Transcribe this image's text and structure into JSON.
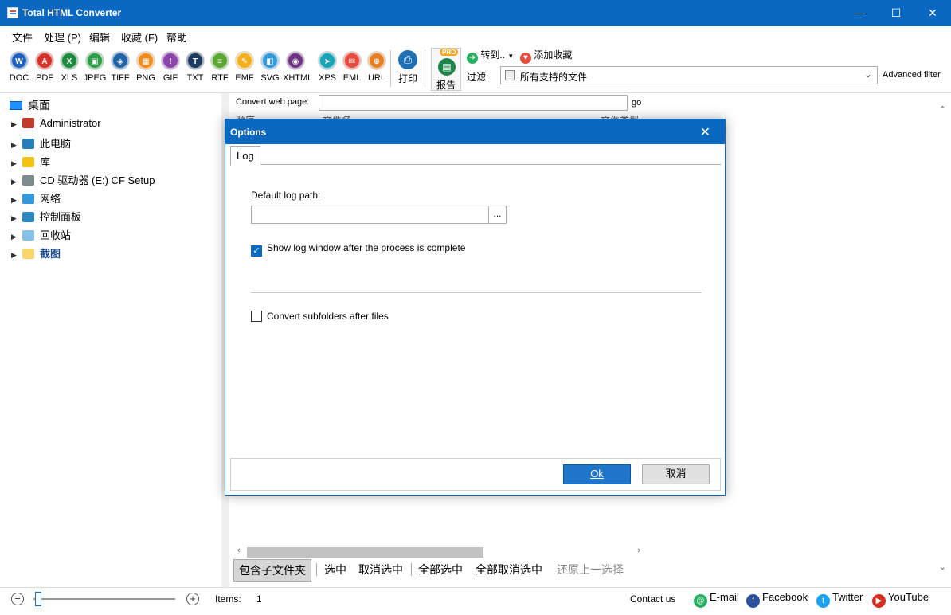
{
  "window": {
    "title": "Total HTML Converter",
    "min": "—",
    "max": "☐",
    "close": "✕"
  },
  "menu": [
    "文件",
    "处理 (P)",
    "编辑",
    "收藏 (F)",
    "帮助"
  ],
  "toolbar": {
    "formats": [
      {
        "label": "DOC",
        "glyph": "W",
        "color": "#1f5fbf",
        "icon": "word-icon"
      },
      {
        "label": "PDF",
        "glyph": "A",
        "color": "#d7322a",
        "icon": "pdf-icon"
      },
      {
        "label": "XLS",
        "glyph": "X",
        "color": "#1e8a3d",
        "icon": "excel-icon"
      },
      {
        "label": "JPEG",
        "glyph": "▣",
        "color": "#2e9e48",
        "icon": "jpeg-icon"
      },
      {
        "label": "TIFF",
        "glyph": "◈",
        "color": "#1f63a8",
        "icon": "tiff-icon"
      },
      {
        "label": "PNG",
        "glyph": "▦",
        "color": "#f08c1e",
        "icon": "png-icon"
      },
      {
        "label": "GIF",
        "glyph": "!",
        "color": "#8e44ad",
        "icon": "gif-icon"
      },
      {
        "label": "TXT",
        "glyph": "T",
        "color": "#1f3a5f",
        "icon": "txt-icon"
      },
      {
        "label": "RTF",
        "glyph": "≡",
        "color": "#5aa832",
        "icon": "rtf-icon"
      },
      {
        "label": "EMF",
        "glyph": "✎",
        "color": "#f2b01e",
        "icon": "emf-icon"
      },
      {
        "label": "SVG",
        "glyph": "◧",
        "color": "#3498db",
        "icon": "svg-icon"
      },
      {
        "label": "XHTML",
        "glyph": "◉",
        "color": "#6c3483",
        "icon": "xhtml-icon"
      },
      {
        "label": "XPS",
        "glyph": "➤",
        "color": "#17a2b8",
        "icon": "xps-icon"
      },
      {
        "label": "EML",
        "glyph": "✉",
        "color": "#e74c3c",
        "icon": "eml-icon"
      },
      {
        "label": "URL",
        "glyph": "⊕",
        "color": "#e67e22",
        "icon": "url-icon"
      }
    ],
    "print_label": "打印",
    "report_label": "报告",
    "pro_badge": "PRO",
    "goto_label": "转到..",
    "fav_label": "添加收藏",
    "filter_label": "过滤:",
    "filter_value": "所有支持的文件",
    "advanced_filter": "Advanced filter"
  },
  "tree": {
    "root": "桌面",
    "items": [
      {
        "label": "Administrator",
        "color": "#c0392b"
      },
      {
        "label": "此电脑",
        "color": "#2980b9"
      },
      {
        "label": "库",
        "color": "#f1c40f"
      },
      {
        "label": "CD 驱动器 (E:) CF Setup",
        "color": "#7f8c8d"
      },
      {
        "label": "网络",
        "color": "#3498db"
      },
      {
        "label": "控制面板",
        "color": "#2e86c1"
      },
      {
        "label": "回收站",
        "color": "#85c1e9"
      },
      {
        "label": "截图",
        "color": "#f9d56e"
      }
    ]
  },
  "center": {
    "convert_web_page": "Convert web page:",
    "go": "go",
    "col1": "顺序",
    "col2": "文件名",
    "col3": "文件类型",
    "actions": [
      "包含子文件夹",
      "选中",
      "取消选中",
      "全部选中",
      "全部取消选中",
      "还原上一选择"
    ]
  },
  "status": {
    "items_label": "Items:",
    "items_value": "1",
    "contact": "Contact us",
    "email": "E-mail",
    "facebook": "Facebook",
    "twitter": "Twitter",
    "youtube": "YouTube"
  },
  "dialog": {
    "title": "Options",
    "tab": "Log",
    "default_log_path_label": "Default log path:",
    "default_log_path_value": "",
    "browse": "...",
    "show_log_label": "Show log window after the process is complete",
    "show_log_checked": true,
    "convert_subfolders_label": "Convert subfolders after files",
    "convert_subfolders_checked": false,
    "ok": "Ok",
    "cancel": "取消"
  }
}
